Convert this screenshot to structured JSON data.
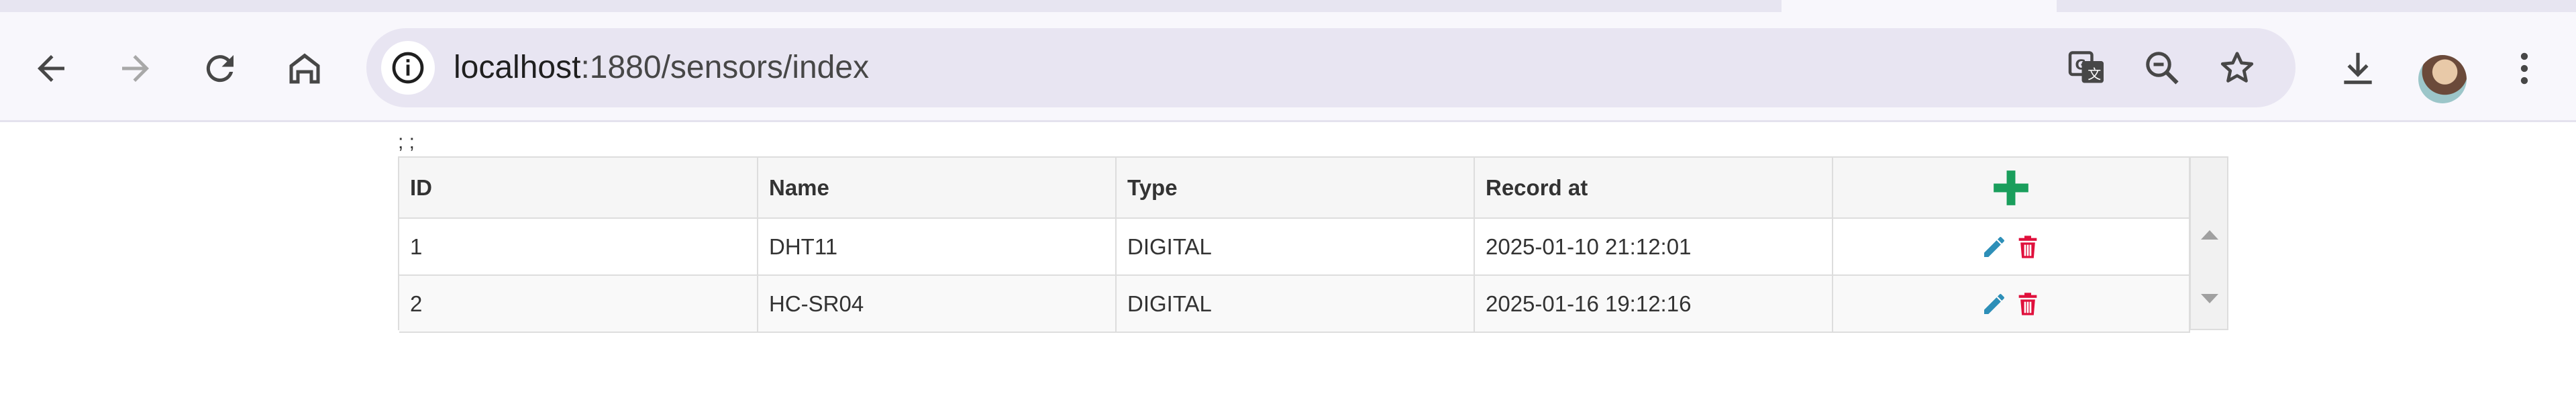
{
  "browser": {
    "url_host": "localhost",
    "url_path": ":1880/sensors/index"
  },
  "page": {
    "stray_text": "; ;",
    "table": {
      "headers": [
        "ID",
        "Name",
        "Type",
        "Record at"
      ],
      "rows": [
        {
          "id": "1",
          "name": "DHT11",
          "type": "DIGITAL",
          "record_at": "2025-01-10 21:12:01"
        },
        {
          "id": "2",
          "name": "HC-SR04",
          "type": "DIGITAL",
          "record_at": "2025-01-16 19:12:16"
        }
      ]
    }
  },
  "colors": {
    "add": "#1a9e5c",
    "edit": "#2d8fb8",
    "delete": "#e0103c"
  }
}
